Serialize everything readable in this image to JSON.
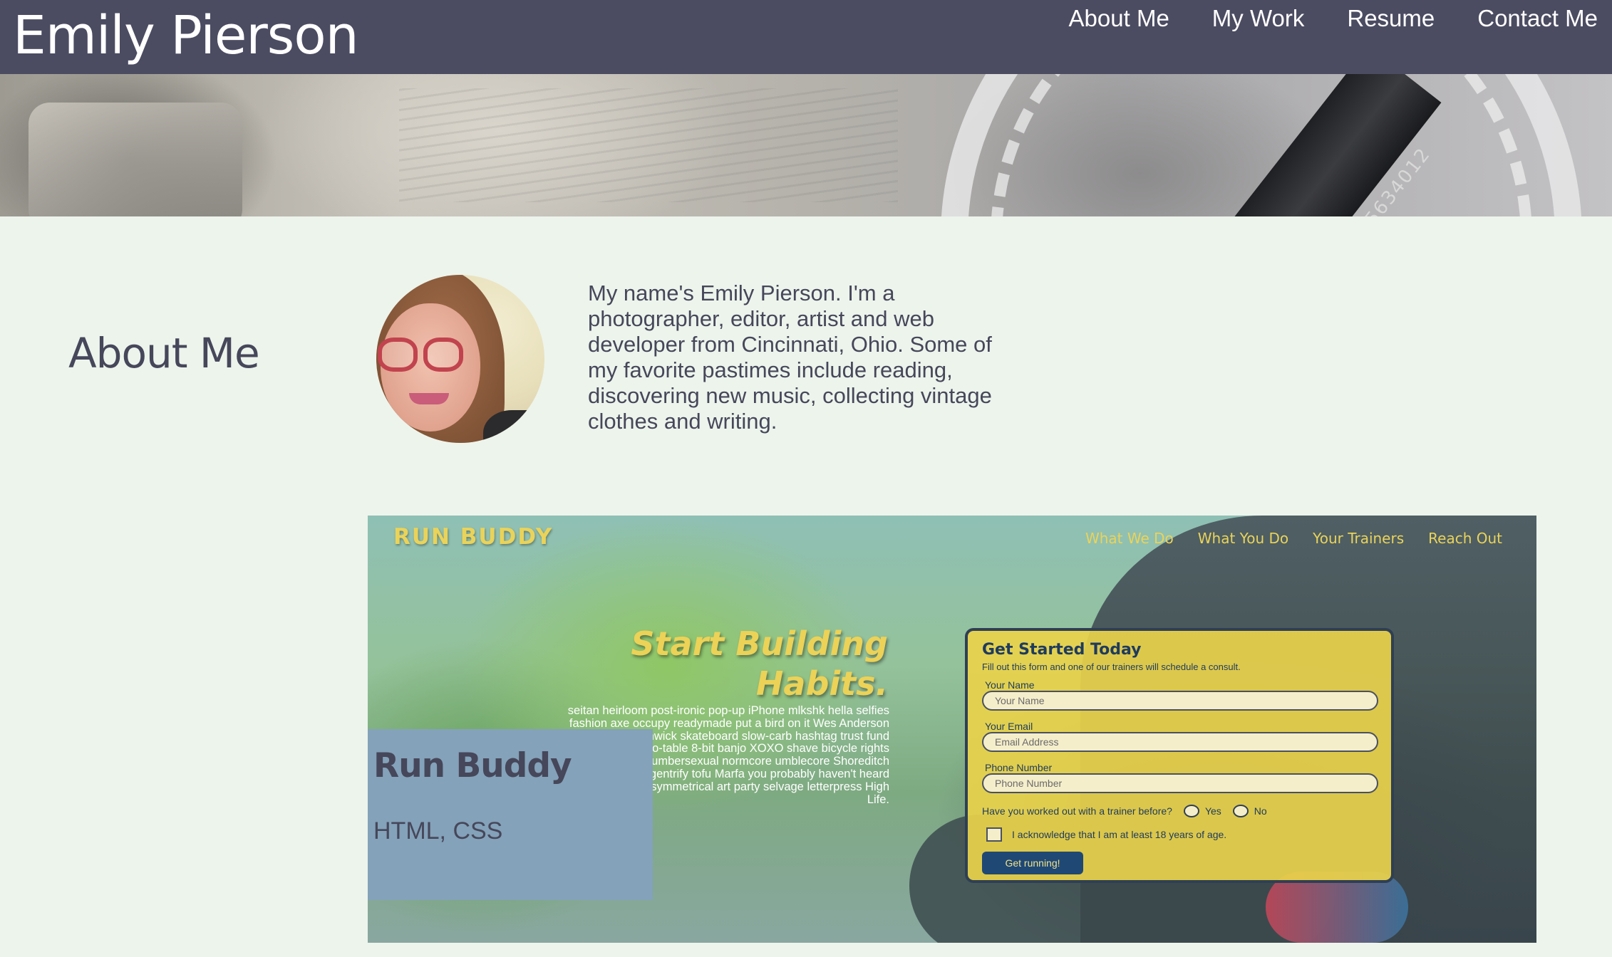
{
  "header": {
    "title": "Emily Pierson",
    "nav": [
      "About Me",
      "My Work",
      "Resume",
      "Contact Me"
    ]
  },
  "hero": {
    "pencil_number": "5634012"
  },
  "about": {
    "heading": "About Me",
    "bio": "My name's Emily Pierson. I'm a photographer, editor, artist and web developer from Cincinnati, Ohio. Some of my favorite pastimes include reading, discovering new music, collecting vintage clothes and writing."
  },
  "project": {
    "name": "Run Buddy",
    "tech": "HTML, CSS",
    "screenshot": {
      "logo": "RUN BUDDY",
      "nav": [
        "What We Do",
        "What You Do",
        "Your Trainers",
        "Reach Out"
      ],
      "hero_title_line1": "Start Building",
      "hero_title_line2": "Habits.",
      "hero_text": "seitan heirloom post-ironic pop-up iPhone mlkshk hella selfies fashion axe occupy readymade put a bird on it Wes Anderson Schlitz plaid Bushwick skateboard slow-carb hashtag trust fund pickled fixie farm-to-table 8-bit banjo XOXO shave bicycle rights retro cliche tattooed lumbersexual normcore umblecore Shoreditch deep v polaroid cray gentrify tofu Marfa you probably haven't heard of them yr banh mi asymmetrical art party selvage letterpress High Life.",
      "form": {
        "title": "Get Started Today",
        "subtitle": "Fill out this form and one of our trainers will schedule a consult.",
        "name_label": "Your Name",
        "name_placeholder": "Your Name",
        "email_label": "Your Email",
        "email_placeholder": "Email Address",
        "phone_label": "Phone Number",
        "phone_placeholder": "Phone Number",
        "question": "Have you worked out with a trainer before?",
        "yes": "Yes",
        "no": "No",
        "acknowledge": "I acknowledge that I am at least 18 years of age.",
        "submit": "Get running!"
      }
    }
  },
  "colors": {
    "header_bg": "#4b4c62",
    "page_bg": "#edf4ec",
    "text": "#46475a",
    "overlay": "#84a2ba",
    "run_buddy_yellow": "#ead35a"
  }
}
